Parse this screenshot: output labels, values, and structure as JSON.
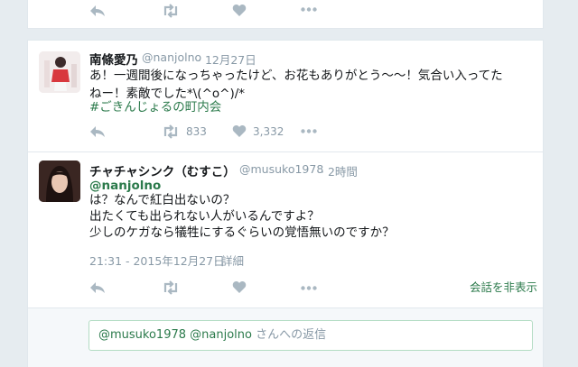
{
  "top_tweet": {
    "actions": {
      "reply_icon": "reply-icon",
      "retweet_icon": "retweet-icon",
      "like_icon": "heart-icon",
      "more_icon": "more-icon"
    }
  },
  "tweet1": {
    "name": "南條愛乃",
    "handle": "@nanjolno",
    "time": "· 12月27日",
    "lines": [
      "あ！一週間後になっちゃったけど、お花もありがとう〜〜！気合い入ってた",
      "ねー！素敵でした*\\(^o^)/*"
    ],
    "hashtag": "#ごきんじょるの町内会",
    "retweets": "833",
    "likes": "3,332"
  },
  "tweet2": {
    "name": "チャチャシンク（むすこ）",
    "handle": "@musuko1978",
    "time": "· 2時間",
    "mention": "@nanjolno",
    "lines": [
      "は？なんで紅白出ないの？",
      "出たくても出られない人がいるんですよ？",
      "少しのケガなら犠牲にするぐらいの覚悟無いのですか？"
    ],
    "timestamp": "21:31 - 2015年12月27日",
    "detail_link": "· 詳細",
    "hide_conversation": "会話を非表示"
  },
  "reply": {
    "mentions": "@musuko1978 @nanjolno",
    "suffix": " さんへの返信"
  },
  "colors": {
    "link": "#2b7a4b",
    "muted": "#8899a6",
    "icon": "#aab8c2",
    "background": "#e6ecf0"
  }
}
